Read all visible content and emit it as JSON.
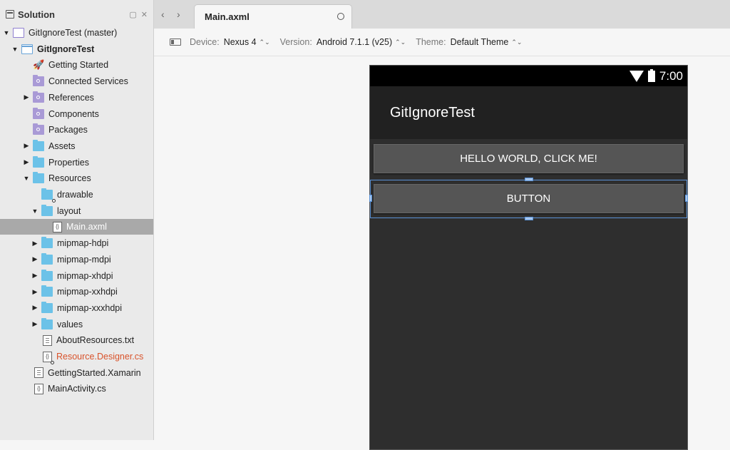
{
  "sidebar": {
    "title": "Solution",
    "tree": [
      {
        "label": "GitIgnoreTest (master)",
        "indent": 0,
        "arrow": "down",
        "icon": "solution-icon"
      },
      {
        "label": "GitIgnoreTest",
        "indent": 1,
        "arrow": "down",
        "icon": "project-icon",
        "bold": true
      },
      {
        "label": "Getting Started",
        "indent": 2,
        "arrow": "none",
        "icon": "rocket-icon"
      },
      {
        "label": "Connected Services",
        "indent": 2,
        "arrow": "none",
        "icon": "purple-folder-icon"
      },
      {
        "label": "References",
        "indent": 2,
        "arrow": "right",
        "icon": "purple-folder-icon"
      },
      {
        "label": "Components",
        "indent": 2,
        "arrow": "none",
        "icon": "purple-folder-icon"
      },
      {
        "label": "Packages",
        "indent": 2,
        "arrow": "none",
        "icon": "purple-folder-icon"
      },
      {
        "label": "Assets",
        "indent": 2,
        "arrow": "right",
        "icon": "folder-icon"
      },
      {
        "label": "Properties",
        "indent": 2,
        "arrow": "right",
        "icon": "folder-icon"
      },
      {
        "label": "Resources",
        "indent": 2,
        "arrow": "down",
        "icon": "folder-icon"
      },
      {
        "label": "drawable",
        "indent": 3,
        "arrow": "none",
        "icon": "folder-icon",
        "dot": true
      },
      {
        "label": "layout",
        "indent": 3,
        "arrow": "down",
        "icon": "folder-icon"
      },
      {
        "label": "Main.axml",
        "indent": 4,
        "arrow": "none",
        "icon": "code-file-icon",
        "selected": true
      },
      {
        "label": "mipmap-hdpi",
        "indent": 3,
        "arrow": "right",
        "icon": "folder-icon"
      },
      {
        "label": "mipmap-mdpi",
        "indent": 3,
        "arrow": "right",
        "icon": "folder-icon"
      },
      {
        "label": "mipmap-xhdpi",
        "indent": 3,
        "arrow": "right",
        "icon": "folder-icon"
      },
      {
        "label": "mipmap-xxhdpi",
        "indent": 3,
        "arrow": "right",
        "icon": "folder-icon"
      },
      {
        "label": "mipmap-xxxhdpi",
        "indent": 3,
        "arrow": "right",
        "icon": "folder-icon"
      },
      {
        "label": "values",
        "indent": 3,
        "arrow": "right",
        "icon": "folder-icon"
      },
      {
        "label": "AboutResources.txt",
        "indent": 3,
        "arrow": "none",
        "icon": "text-file-icon"
      },
      {
        "label": "Resource.Designer.cs",
        "indent": 3,
        "arrow": "none",
        "icon": "code-file-icon",
        "dot": true,
        "red": true
      },
      {
        "label": "GettingStarted.Xamarin",
        "indent": 2,
        "arrow": "none",
        "icon": "text-file-icon"
      },
      {
        "label": "MainActivity.cs",
        "indent": 2,
        "arrow": "none",
        "icon": "code-file-icon"
      }
    ]
  },
  "tabs": {
    "back": "‹",
    "forward": "›",
    "active": "Main.axml"
  },
  "toolbar": {
    "device_label": "Device:",
    "device_value": "Nexus 4",
    "version_label": "Version:",
    "version_value": "Android 7.1.1 (v25)",
    "theme_label": "Theme:",
    "theme_value": "Default Theme",
    "caret": "⌃⌄"
  },
  "phone": {
    "time": "7:00",
    "app_title": "GitIgnoreTest",
    "button1": "HELLO WORLD, CLICK ME!",
    "button2": "BUTTON"
  }
}
